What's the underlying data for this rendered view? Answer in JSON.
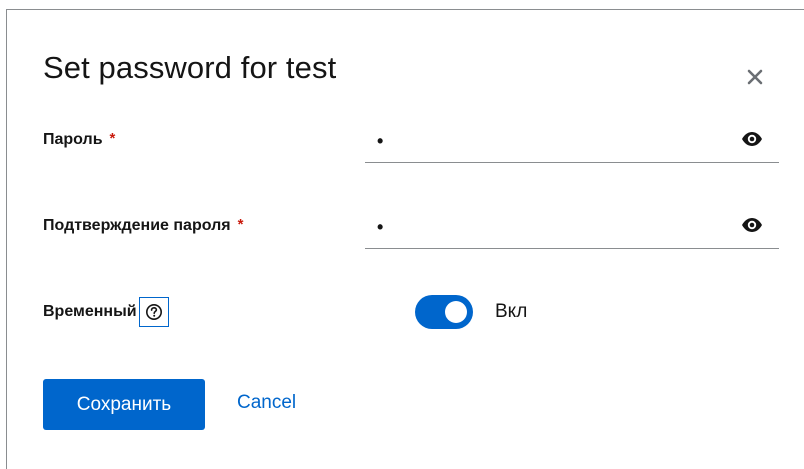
{
  "modal": {
    "title": "Set password for test",
    "close_icon": "close-icon"
  },
  "form": {
    "password": {
      "label": "Пароль",
      "required_marker": "*",
      "masked_value": "•",
      "toggle_icon": "eye-icon"
    },
    "password_confirm": {
      "label": "Подтверждение пароля",
      "required_marker": "*",
      "masked_value": "•",
      "toggle_icon": "eye-icon"
    },
    "temporary": {
      "label": "Временный",
      "help_icon": "help-icon",
      "switch_on": true,
      "switch_label": "Вкл"
    }
  },
  "actions": {
    "save_label": "Сохранить",
    "cancel_label": "Cancel"
  },
  "colors": {
    "primary": "#0066cc",
    "required": "#c9190b",
    "text": "#151515",
    "border": "#8a8d90"
  }
}
